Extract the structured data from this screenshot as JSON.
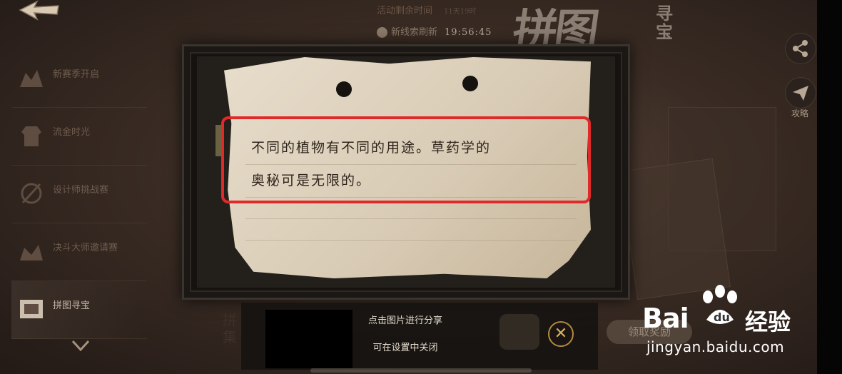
{
  "header": {
    "event_time_label": "活动剩余时间",
    "event_time_value": "11天19时",
    "refresh_label": "新线索刷新",
    "refresh_time": "19:56:45",
    "logo_main": "拼图",
    "logo_sub": "寻宝"
  },
  "sidebar": {
    "items": [
      {
        "label": "新赛季开启",
        "icon": "season-icon"
      },
      {
        "label": "流金时光",
        "icon": "costume-icon"
      },
      {
        "label": "设计师挑战赛",
        "icon": "design-icon"
      },
      {
        "label": "决斗大师邀请赛",
        "icon": "duel-icon"
      },
      {
        "label": "拼图寻宝",
        "icon": "puzzle-icon",
        "active": true
      }
    ]
  },
  "right_buttons": {
    "guide_label": "攻略"
  },
  "note": {
    "line1": "不同的植物有不同的用途。草药学的",
    "line2": "奥秘可是无限的。"
  },
  "background": {
    "collect_label": "领取奖励"
  },
  "toast": {
    "line1": "点击图片进行分享",
    "line2": "可在设置中关闭"
  },
  "watermark": {
    "brand": "Bai",
    "brand_cn": "经验",
    "url": "jingyan.baidu.com"
  },
  "colors": {
    "highlight": "#e02a2a",
    "close_ring": "#b38a3c",
    "paper": "#e7ddcb"
  }
}
